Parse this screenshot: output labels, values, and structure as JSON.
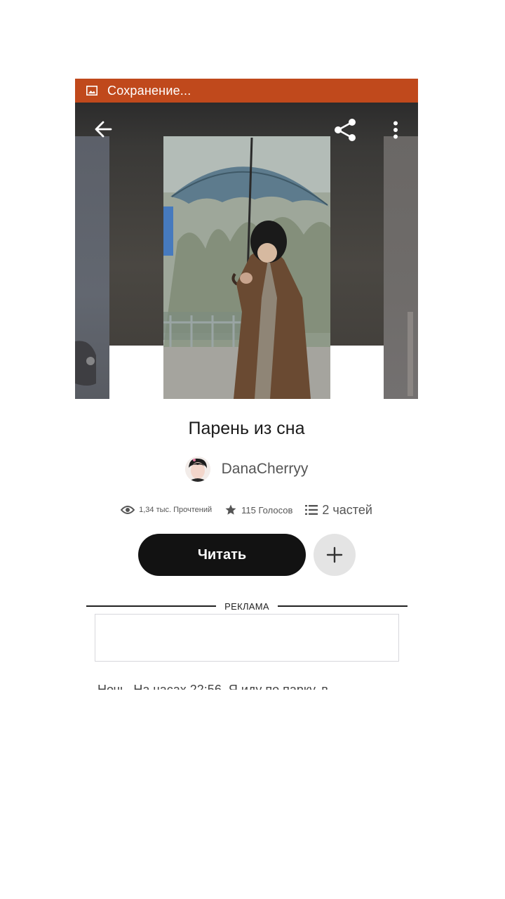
{
  "notification": {
    "text": "Сохранение...",
    "icon": "image-icon",
    "color": "#c0491c"
  },
  "topbar": {
    "back_icon": "arrow-left-icon",
    "share_icon": "share-icon",
    "more_icon": "more-vert-icon"
  },
  "story": {
    "title": "Парень из сна",
    "author": "DanaCherryy",
    "stats": {
      "reads": "1,34 тыс. Прочтений",
      "votes": "115 Голосов",
      "parts": "2 частей"
    },
    "read_button": "Читать",
    "add_icon": "plus-icon",
    "snippet": "Ночь. На часах 22:56. Я иду по парку, в"
  },
  "ad": {
    "label": "РЕКЛАМА"
  }
}
